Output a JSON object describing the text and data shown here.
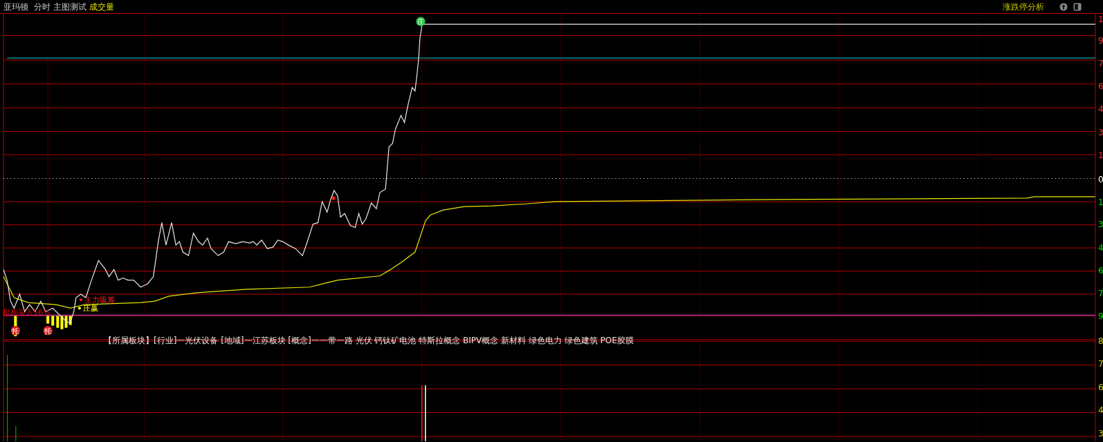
{
  "header": {
    "stock_name": "亚玛顿",
    "period": "分时",
    "template": "主图测试",
    "indicator": "成交量"
  },
  "top_right": {
    "title": "涨跌停分析"
  },
  "axis_labels": [
    {
      "text": "1",
      "kind": "up"
    },
    {
      "text": "9",
      "kind": "up"
    },
    {
      "text": "7",
      "kind": "up"
    },
    {
      "text": "6",
      "kind": "up"
    },
    {
      "text": "4",
      "kind": "up"
    },
    {
      "text": "3",
      "kind": "up"
    },
    {
      "text": "1",
      "kind": "up"
    },
    {
      "text": "0",
      "kind": "zero"
    },
    {
      "text": "1",
      "kind": "down"
    },
    {
      "text": "3",
      "kind": "down"
    },
    {
      "text": "4",
      "kind": "down"
    },
    {
      "text": "6",
      "kind": "down"
    },
    {
      "text": "7",
      "kind": "down"
    },
    {
      "text": "9",
      "kind": "down"
    },
    {
      "text": "8",
      "kind": "volume"
    },
    {
      "text": "7",
      "kind": "volume"
    },
    {
      "text": "6",
      "kind": "volume"
    },
    {
      "text": "4",
      "kind": "volume"
    },
    {
      "text": "3",
      "kind": "volume"
    }
  ],
  "signals": [
    {
      "text": "主力吸筹",
      "color": "#ff2020"
    },
    {
      "text": "庄赢",
      "color": "#ffff00"
    },
    {
      "text": "机构买入56%",
      "color": "#e00000"
    }
  ],
  "badges": [
    {
      "text": "托",
      "kind": "support"
    },
    {
      "text": "托",
      "kind": "support"
    },
    {
      "text": "庄",
      "kind": "peak"
    }
  ],
  "sector_info": "【所属板块】[行业]一光伏设备 [地域]一江苏板块 [概念]一一带一路 光伏 钙钛矿电池 特斯拉概念 BIPV概念 新材料 绿色电力 绿色建筑 POE胶膜"
}
